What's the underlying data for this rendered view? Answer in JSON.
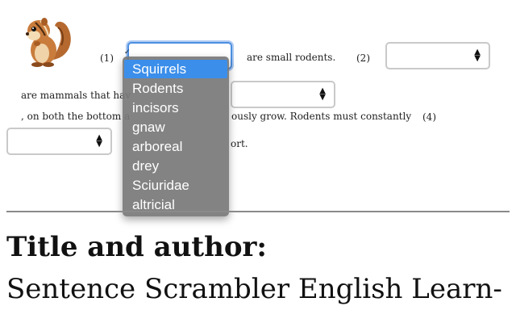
{
  "question_numbers": [
    "(1)",
    "(2)",
    "(4)"
  ],
  "sentence": {
    "frag_1": "are small rodents.",
    "frag_2a": "are mammals that hav",
    "frag_3a": ", on both the bottom a",
    "frag_3b": "ously grow. Rodents must constantly",
    "frag_4": "ort."
  },
  "dropdown": {
    "options": [
      "Squirrels",
      "Rodents",
      "incisors",
      "gnaw",
      "arboreal",
      "drey",
      "Sciuridae",
      "altricial"
    ],
    "selected_index": 0
  },
  "footer": {
    "title": "Title and author:",
    "subtitle": "Sentence Scrambler English Learn-"
  },
  "icons": {
    "mascot": "chipmunk-icon",
    "select_arrow": "updown-chevron-icon"
  },
  "colors": {
    "highlight": "#3b8eea",
    "focus_ring": "#4d8fe0"
  }
}
